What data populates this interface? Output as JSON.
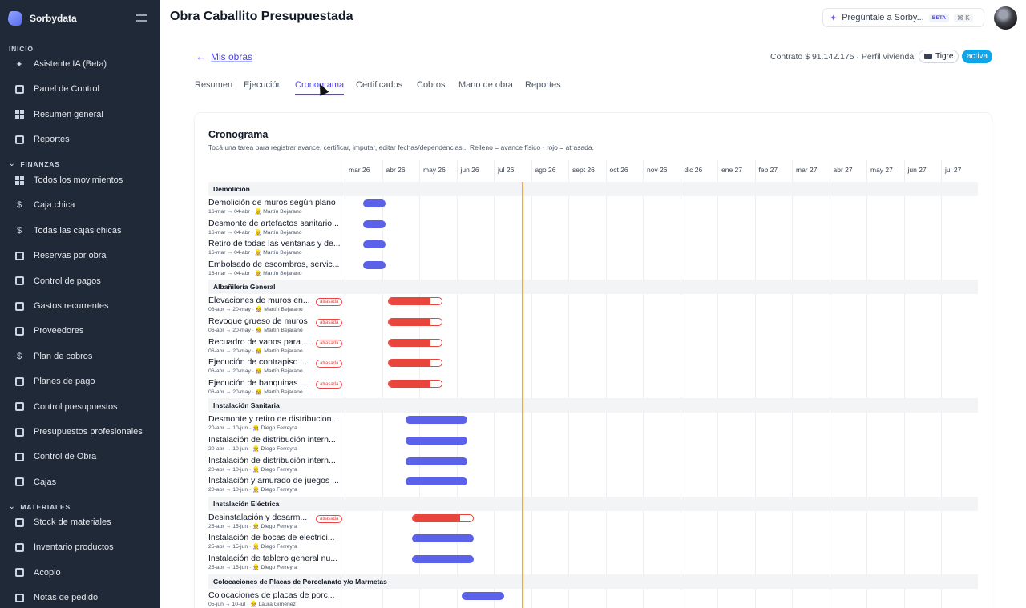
{
  "brand": {
    "name": "Sorbydata"
  },
  "sidebar": {
    "inicio_label": "INICIO",
    "finanzas_label": "FINANZAS",
    "materiales_label": "MATERIALES",
    "inicio": [
      "Asistente IA (Beta)",
      "Panel de Control",
      "Resumen general",
      "Reportes"
    ],
    "finanzas": [
      "Todos los movimientos",
      "Caja chica",
      "Todas las cajas chicas",
      "Reservas por obra",
      "Control de pagos",
      "Gastos recurrentes",
      "Proveedores",
      "Plan de cobros",
      "Planes de pago",
      "Control presupuestos",
      "Presupuestos profesionales",
      "Control de Obra",
      "Cajas"
    ],
    "materiales": [
      "Stock de materiales",
      "Inventario productos",
      "Acopio",
      "Notas de pedido"
    ]
  },
  "header": {
    "title": "Obra Caballito Presupuestada",
    "ask": "Pregúntale a Sorby...",
    "beta": "BETA",
    "shortcut": "⌘ K"
  },
  "project": {
    "back": "Mis obras",
    "contract": "Contrato $ 91.142.175 · Perfil vivienda",
    "tag": "Tigre",
    "status": "activa"
  },
  "tabs": [
    "Resumen",
    "Ejecución",
    "Cronograma",
    "Certificados",
    "Cobros",
    "Mano de obra",
    "Reportes"
  ],
  "cronograma": {
    "title": "Cronograma",
    "subtitle": "Tocá una tarea para registrar avance, certificar, imputar, editar fechas/dependencias... Relleno = avance físico · rojo = atrasada.",
    "months": [
      "mar 26",
      "abr 26",
      "may 26",
      "jun 26",
      "jul 26",
      "ago 26",
      "sept 26",
      "oct 26",
      "nov 26",
      "dic 26",
      "ene 27",
      "feb 27",
      "mar 27",
      "abr 27",
      "may 27",
      "jun 27",
      "jul 27"
    ],
    "late_label": "atrasada",
    "groups": [
      {
        "name": "Demolición",
        "tasks": [
          {
            "name": "Demolición de muros según plano",
            "meta": "16-mar → 04-abr · 👷 Martín Bejarano",
            "late": false,
            "progress": 0
          },
          {
            "name": "Desmonte de artefactos sanitario...",
            "meta": "16-mar → 04-abr · 👷 Martín Bejarano",
            "late": false,
            "progress": 0
          },
          {
            "name": "Retiro de todas las ventanas y de...",
            "meta": "16-mar → 04-abr · 👷 Martín Bejarano",
            "late": false,
            "progress": 0
          },
          {
            "name": "Embolsado de escombros, servic...",
            "meta": "16-mar → 04-abr · 👷 Martín Bejarano",
            "late": false,
            "progress": 0
          }
        ]
      },
      {
        "name": "Albañilería General",
        "tasks": [
          {
            "name": "Elevaciones de muros en...",
            "meta": "06-abr → 20-may · 👷 Martín Bejarano",
            "late": true,
            "progress": 0.8
          },
          {
            "name": "Revoque grueso de muros",
            "meta": "06-abr → 20-may · 👷 Martín Bejarano",
            "late": true,
            "progress": 0.8
          },
          {
            "name": "Recuadro de vanos para ...",
            "meta": "06-abr → 20-may · 👷 Martín Bejarano",
            "late": true,
            "progress": 0.8
          },
          {
            "name": "Ejecución de contrapiso ...",
            "meta": "06-abr → 20-may · 👷 Martín Bejarano",
            "late": true,
            "progress": 0.8
          },
          {
            "name": "Ejecución de banquinas ...",
            "meta": "06-abr → 20-may · 👷 Martín Bejarano",
            "late": true,
            "progress": 0.8
          }
        ]
      },
      {
        "name": "Instalación Sanitaria",
        "tasks": [
          {
            "name": "Desmonte y retiro de distribucion...",
            "meta": "20-abr → 10-jun · 👷 Diego Ferreyra",
            "late": false,
            "progress": 0
          },
          {
            "name": "Instalación de distribución intern...",
            "meta": "20-abr → 10-jun · 👷 Diego Ferreyra",
            "late": false,
            "progress": 0
          },
          {
            "name": "Instalación de distribución intern...",
            "meta": "20-abr → 10-jun · 👷 Diego Ferreyra",
            "late": false,
            "progress": 0
          },
          {
            "name": "Instalación y amurado de juegos ...",
            "meta": "20-abr → 10-jun · 👷 Diego Ferreyra",
            "late": false,
            "progress": 0
          }
        ]
      },
      {
        "name": "Instalación Eléctrica",
        "tasks": [
          {
            "name": "Desinstalación y desarm...",
            "meta": "25-abr → 15-jun · 👷 Diego Ferreyra",
            "late": true,
            "progress": 0.78
          },
          {
            "name": "Instalación de bocas de electrici...",
            "meta": "25-abr → 15-jun · 👷 Diego Ferreyra",
            "late": false,
            "progress": 0
          },
          {
            "name": "Instalación de tablero general nu...",
            "meta": "25-abr → 15-jun · 👷 Diego Ferreyra",
            "late": false,
            "progress": 0
          }
        ]
      },
      {
        "name": "Colocaciones de Placas de Porcelanato y/o Marmetas",
        "tasks": [
          {
            "name": "Colocaciones de placas de porc...",
            "meta": "05-jun → 10-jul · 👷 Laura Giménez",
            "late": false,
            "progress": 0
          }
        ]
      }
    ]
  }
}
